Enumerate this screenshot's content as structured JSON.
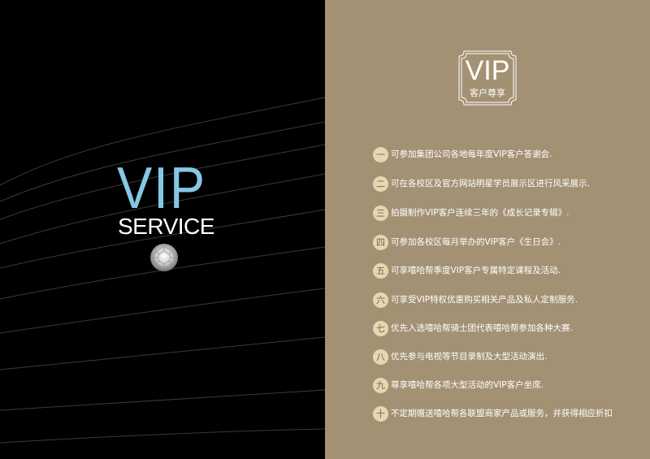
{
  "left_panel": {
    "vip_text": "VIP",
    "service_text": "SERVICE"
  },
  "right_panel": {
    "badge": {
      "vip": "VIP",
      "subtitle": "客户尊享"
    },
    "benefits": [
      {
        "num": "一",
        "text": "可参加集团公司各地每年度VIP客户答谢会."
      },
      {
        "num": "二",
        "text": "可在各校区及官方网站明星学员展示区进行风采展示."
      },
      {
        "num": "三",
        "text": "拍摄制作VIP客户连续三年的《成长记录专辑》."
      },
      {
        "num": "四",
        "text": "可参加各校区每月举办的VIP客户《生日会》."
      },
      {
        "num": "五",
        "text": "可享嘻哈帮季度VIP客户专属特定课程及活动."
      },
      {
        "num": "六",
        "text": "可享受VIP特权优惠购买相关产品及私人定制服务."
      },
      {
        "num": "七",
        "text": "优先入选嘻哈帮骑士团代表嘻哈帮参加各种大赛."
      },
      {
        "num": "八",
        "text": "优先参与电视等节目录制及大型活动演出."
      },
      {
        "num": "九",
        "text": "尊享嘻哈帮各项大型活动的VIP客户坐席."
      },
      {
        "num": "十",
        "text": "不定期赠送嘻哈帮各联盟商家产品或服务，并获得相应折扣"
      }
    ]
  },
  "colors": {
    "left_bg": "#000000",
    "right_bg": "#a39174",
    "vip_blue": "#86c7e6",
    "number_circle": "#e6d7b3"
  }
}
